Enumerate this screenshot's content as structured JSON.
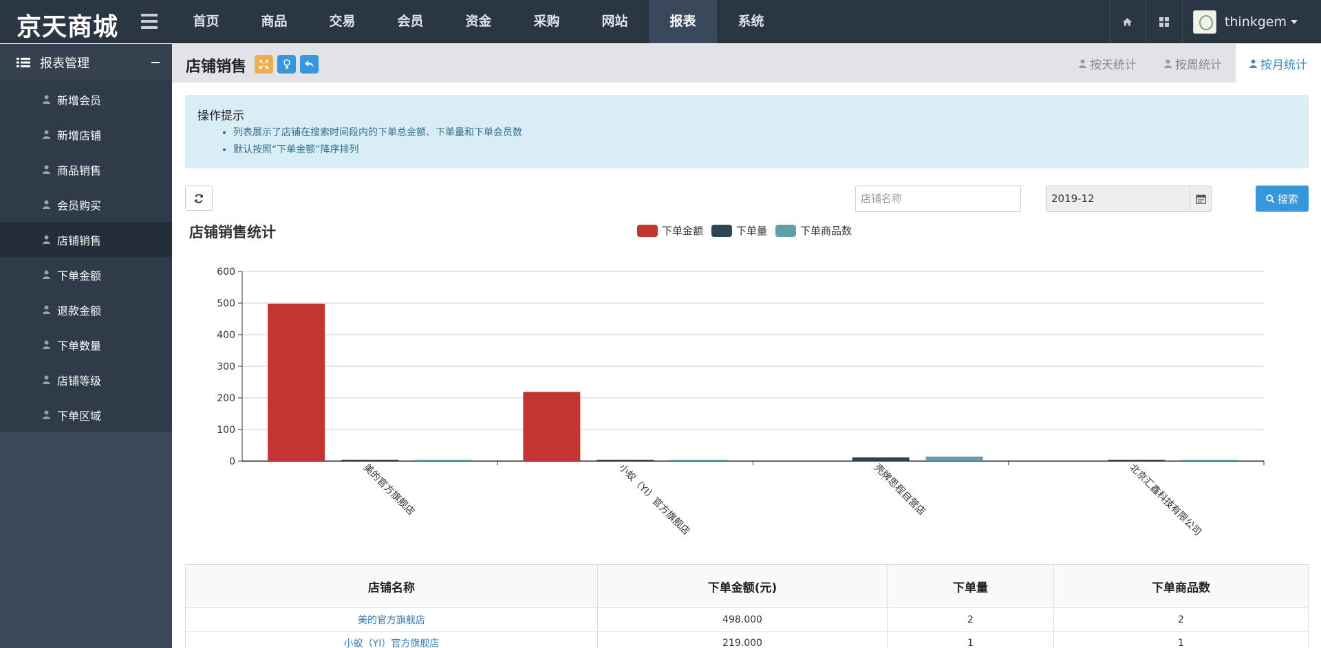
{
  "app": {
    "logo": "京天商城",
    "user_name": "thinkgem"
  },
  "topnav": [
    {
      "label": "首页"
    },
    {
      "label": "商品"
    },
    {
      "label": "交易"
    },
    {
      "label": "会员"
    },
    {
      "label": "资金"
    },
    {
      "label": "采购"
    },
    {
      "label": "网站"
    },
    {
      "label": "报表",
      "active": true
    },
    {
      "label": "系统"
    }
  ],
  "sidebar": {
    "title": "报表管理",
    "items": [
      {
        "label": "新增会员"
      },
      {
        "label": "新增店铺"
      },
      {
        "label": "商品销售"
      },
      {
        "label": "会员购买"
      },
      {
        "label": "店铺销售",
        "active": true
      },
      {
        "label": "下单金额"
      },
      {
        "label": "退款金额"
      },
      {
        "label": "下单数量"
      },
      {
        "label": "店铺等级"
      },
      {
        "label": "下单区域"
      }
    ]
  },
  "page": {
    "title": "店铺销售",
    "tabs": [
      {
        "label": "按天统计"
      },
      {
        "label": "按周统计"
      },
      {
        "label": "按月统计",
        "active": true
      }
    ]
  },
  "tips": {
    "title": "操作提示",
    "items": [
      "列表展示了店铺在搜索时间段内的下单总金额、下单量和下单会员数",
      "默认按照“下单金额”降序排列"
    ]
  },
  "search": {
    "shop_placeholder": "店铺名称",
    "date_value": "2019-12",
    "button_label": "搜索"
  },
  "colors": {
    "amount": "#c23531",
    "orders": "#2f4554",
    "goods": "#61a0a8",
    "accent": "#3598dc"
  },
  "chart_data": {
    "type": "bar",
    "title": "店铺销售统计",
    "categories": [
      "美的官方旗舰店",
      "小蚁（YI）官方旗舰店",
      "壳牌思程自营店",
      "北京汇鑫科技有限公司"
    ],
    "series": [
      {
        "name": "下单金额",
        "values": [
          498,
          219,
          0,
          0
        ]
      },
      {
        "name": "下单量",
        "values": [
          2,
          1,
          12,
          2
        ]
      },
      {
        "name": "下单商品数",
        "values": [
          2,
          1,
          14,
          3
        ]
      }
    ],
    "ylim": [
      0,
      600
    ],
    "yticks": [
      "0",
      "100",
      "200",
      "300",
      "400",
      "500",
      "600"
    ],
    "grid": true,
    "legend": "top-center"
  },
  "table": {
    "headers": [
      "店铺名称",
      "下单金额(元)",
      "下单量",
      "下单商品数"
    ],
    "rows": [
      [
        "美的官方旗舰店",
        "498.000",
        "2",
        "2"
      ],
      [
        "小蚁（YI）官方旗舰店",
        "219.000",
        "1",
        "1"
      ]
    ]
  }
}
